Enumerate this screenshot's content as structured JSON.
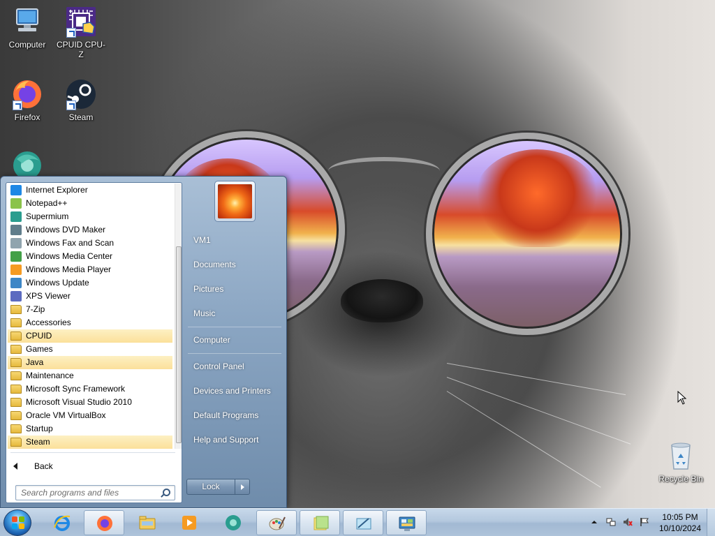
{
  "desktop": {
    "icons": [
      {
        "label": "Computer",
        "icon": "computer-icon"
      },
      {
        "label": "CPUID CPU-Z",
        "icon": "cpuz-icon"
      },
      {
        "label": "Firefox",
        "icon": "firefox-icon"
      },
      {
        "label": "Steam",
        "icon": "steam-icon"
      },
      {
        "label": "",
        "icon": "supermium-icon"
      },
      {
        "label": "Recycle Bin",
        "icon": "recycle-bin-icon"
      }
    ]
  },
  "start_menu": {
    "programs": [
      {
        "label": "Internet Explorer",
        "icon": "ie-icon",
        "type": "app"
      },
      {
        "label": "Notepad++",
        "icon": "notepadpp-icon",
        "type": "app"
      },
      {
        "label": "Supermium",
        "icon": "supermium-icon",
        "type": "app"
      },
      {
        "label": "Windows DVD Maker",
        "icon": "dvd-maker-icon",
        "type": "app"
      },
      {
        "label": "Windows Fax and Scan",
        "icon": "fax-scan-icon",
        "type": "app"
      },
      {
        "label": "Windows Media Center",
        "icon": "media-center-icon",
        "type": "app"
      },
      {
        "label": "Windows Media Player",
        "icon": "media-player-icon",
        "type": "app"
      },
      {
        "label": "Windows Update",
        "icon": "windows-update-icon",
        "type": "app"
      },
      {
        "label": "XPS Viewer",
        "icon": "xps-viewer-icon",
        "type": "app"
      },
      {
        "label": "7-Zip",
        "icon": "folder-icon",
        "type": "folder"
      },
      {
        "label": "Accessories",
        "icon": "folder-icon",
        "type": "folder"
      },
      {
        "label": "CPUID",
        "icon": "folder-icon",
        "type": "folder",
        "highlighted": true
      },
      {
        "label": "Games",
        "icon": "folder-icon",
        "type": "folder"
      },
      {
        "label": "Java",
        "icon": "folder-icon",
        "type": "folder",
        "highlighted": true
      },
      {
        "label": "Maintenance",
        "icon": "folder-icon",
        "type": "folder"
      },
      {
        "label": "Microsoft Sync Framework",
        "icon": "folder-icon",
        "type": "folder"
      },
      {
        "label": "Microsoft Visual Studio 2010",
        "icon": "folder-icon",
        "type": "folder"
      },
      {
        "label": "Oracle VM VirtualBox",
        "icon": "folder-icon",
        "type": "folder"
      },
      {
        "label": "Startup",
        "icon": "folder-icon",
        "type": "folder"
      },
      {
        "label": "Steam",
        "icon": "folder-icon",
        "type": "folder",
        "highlighted": true
      }
    ],
    "back_label": "Back",
    "search_placeholder": "Search programs and files",
    "right_items": {
      "user": "VM1",
      "documents": "Documents",
      "pictures": "Pictures",
      "music": "Music",
      "computer": "Computer",
      "control_panel": "Control Panel",
      "devices_printers": "Devices and Printers",
      "default_programs": "Default Programs",
      "help_support": "Help and Support"
    },
    "lock_label": "Lock"
  },
  "taskbar": {
    "pinned": [
      {
        "icon": "internet-explorer-icon",
        "active": false
      },
      {
        "icon": "firefox-icon",
        "active": true
      },
      {
        "icon": "windows-explorer-icon",
        "active": false
      },
      {
        "icon": "media-player-icon",
        "active": false
      },
      {
        "icon": "supermium-icon",
        "active": false
      },
      {
        "icon": "paint-icon",
        "active": true
      },
      {
        "icon": "sticky-notes-icon",
        "active": true
      },
      {
        "icon": "snipping-tool-icon",
        "active": true
      },
      {
        "icon": "control-panel-icon",
        "active": true
      }
    ],
    "clock_time": "10:05 PM",
    "clock_date": "10/10/2024"
  },
  "colors": {
    "start_menu_glass": "#8aa5c2",
    "highlight": "#fbe09a",
    "taskbar": "#b4c8de"
  }
}
